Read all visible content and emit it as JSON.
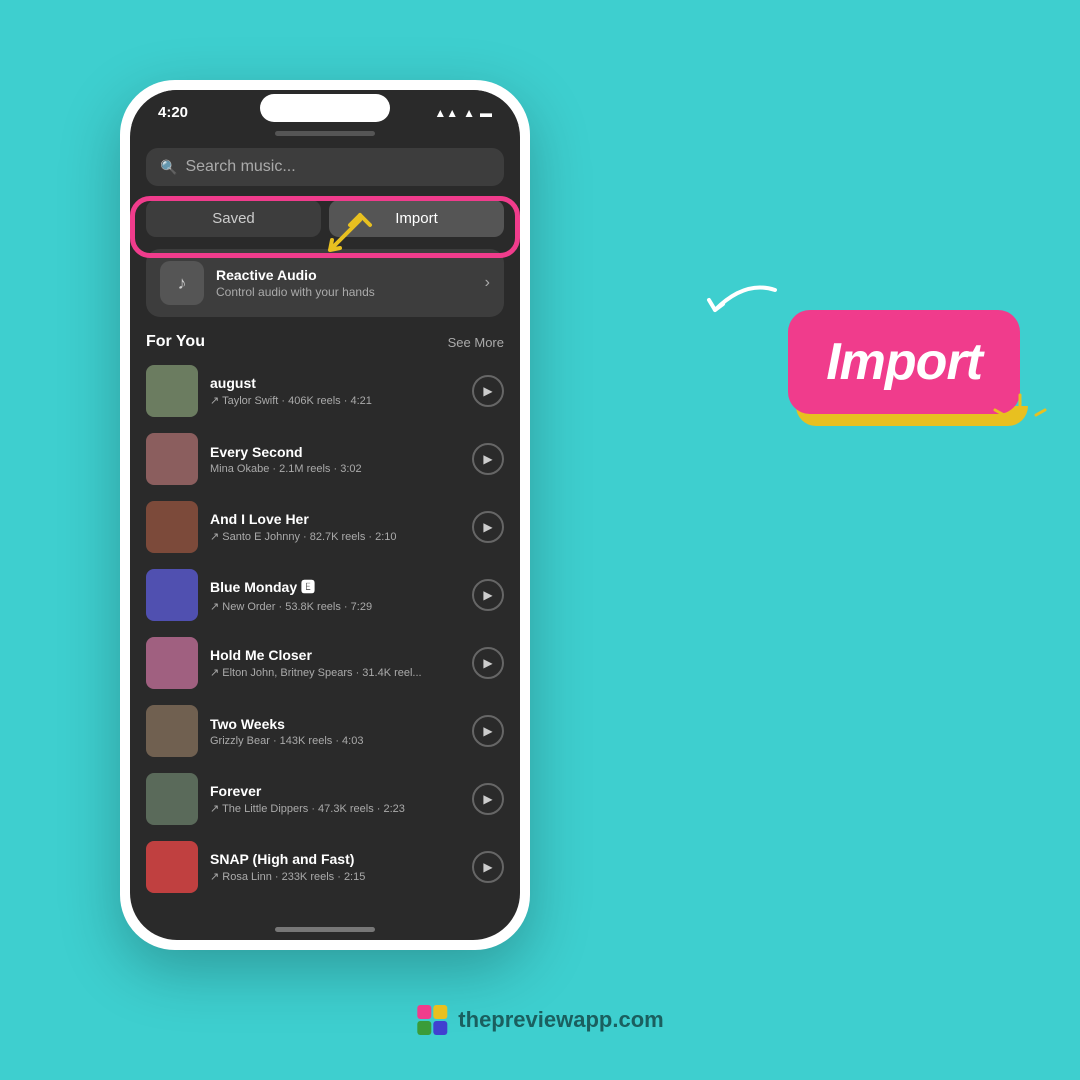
{
  "app": {
    "status_time": "4:20",
    "status_icons": "▲ ⬛ 🔋"
  },
  "search": {
    "placeholder": "Search music..."
  },
  "tabs": {
    "saved": "Saved",
    "import": "Import"
  },
  "reactive": {
    "title": "Reactive Audio",
    "subtitle": "Control audio with your hands"
  },
  "for_you": {
    "section_title": "For You",
    "see_more": "See More"
  },
  "songs": [
    {
      "title": "august",
      "meta": "↗ Taylor Swift · 406K reels · 4:21",
      "color": "#6b7c60"
    },
    {
      "title": "Every Second",
      "meta": "Mina Okabe · 2.1M reels · 3:02",
      "color": "#8b5e5e"
    },
    {
      "title": "And I Love Her",
      "meta": "↗ Santo E Johnny · 82.7K reels · 2:10",
      "color": "#7c4a3a"
    },
    {
      "title": "Blue Monday 🅴",
      "meta": "↗ New Order · 53.8K reels · 7:29",
      "color": "#5050b0"
    },
    {
      "title": "Hold Me Closer",
      "meta": "↗ Elton John, Britney Spears · 31.4K reel...",
      "color": "#a06080"
    },
    {
      "title": "Two Weeks",
      "meta": "Grizzly Bear · 143K reels · 4:03",
      "color": "#706050"
    },
    {
      "title": "Forever",
      "meta": "↗ The Little Dippers · 47.3K reels · 2:23",
      "color": "#5a6a5a"
    },
    {
      "title": "SNAP (High and Fast)",
      "meta": "↗ Rosa Linn · 233K reels · 2:15",
      "color": "#c04040"
    }
  ],
  "import_badge": {
    "label": "Import"
  },
  "bottom_logo": {
    "text": "thepreviewapp.com"
  }
}
